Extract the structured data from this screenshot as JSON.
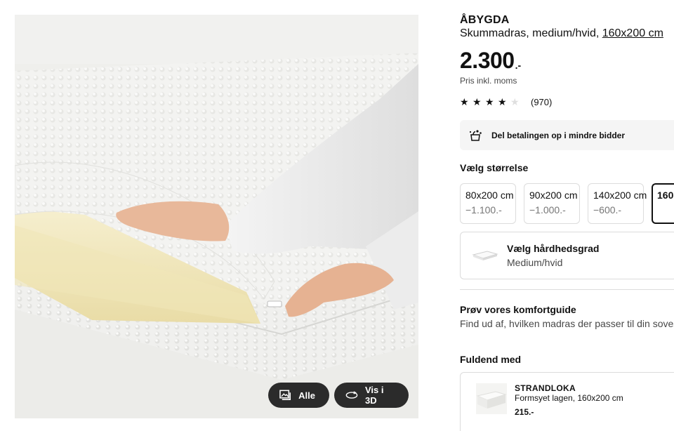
{
  "gallery": {
    "image_alt": "",
    "buttons": {
      "all_label": "Alle",
      "view3d_label": "Vis i 3D"
    }
  },
  "product": {
    "name": "ÅBYGDA",
    "description": "Skummadras, medium/hvid, ",
    "size_link": "160x200 cm",
    "price_main": "2.300",
    "price_suffix": ".-",
    "vat_note": "Pris inkl. moms",
    "rating": {
      "stars": 4,
      "max": 5,
      "count_text": "(970)"
    }
  },
  "payment": {
    "label": "Del betalingen op i mindre bidder",
    "icon": "payment-installments-icon"
  },
  "size_section": {
    "heading": "Vælg størrelse",
    "options": [
      {
        "name": "80x200 cm",
        "diff": "−1.100.-"
      },
      {
        "name": "90x200 cm",
        "diff": "−1.000.-"
      },
      {
        "name": "140x200 cm",
        "diff": "−600.-"
      },
      {
        "name": "160",
        "diff": ""
      }
    ],
    "selected_index": 3
  },
  "firmness": {
    "heading": "Vælg hårdhedsgrad",
    "value": "Medium/hvid"
  },
  "comfort_guide": {
    "title": "Prøv vores komfortguide",
    "subtitle": "Find ud af, hvilken madras der passer til din sovesti"
  },
  "complete_with": {
    "heading": "Fuldend med",
    "items": [
      {
        "brand": "STRANDLOKA",
        "description": "Formsyet lagen, 160x200 cm",
        "price": "215.-"
      }
    ]
  },
  "colors": {
    "accent": "#111111",
    "border": "#dcdcdc",
    "muted": "#767676",
    "panel": "#f5f5f5",
    "overlay_button": "#2b2b2b"
  }
}
